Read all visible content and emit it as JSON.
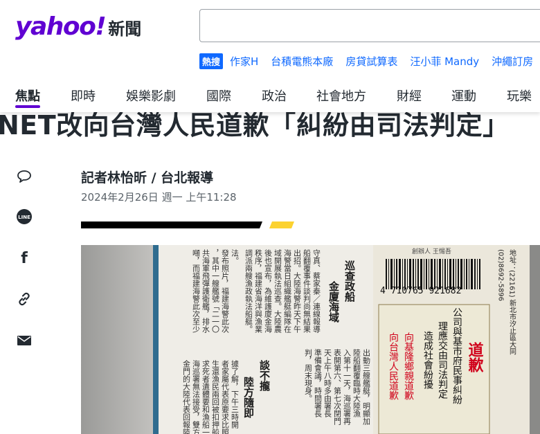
{
  "header": {
    "logo_text": "yahoo!",
    "section_label": "新聞",
    "search_placeholder": ""
  },
  "trending": {
    "badge": "熱搜",
    "items": [
      "作家H",
      "台積電熊本廠",
      "房貸試算表",
      "汪小菲 Mandy",
      "沖繩訂房"
    ]
  },
  "nav": {
    "items": [
      "焦點",
      "即時",
      "娛樂影劇",
      "國際",
      "政治",
      "社會地方",
      "財經",
      "運動",
      "玩樂"
    ],
    "active_index": 0
  },
  "article": {
    "headline": "NET改向台灣人民道歉「糾紛由司法判定」",
    "author": "記者林怡昕 / 台北報導",
    "date": "2024年2月26日 週一 上午11:28"
  },
  "share": {
    "icons": [
      "comment-icon",
      "line-icon",
      "facebook-icon",
      "link-icon",
      "mail-icon"
    ],
    "line_label": "LINE",
    "facebook_label": "f"
  },
  "photo": {
    "ad_label": "道歉",
    "ad_lines": [
      "公司與基市府民事糾紛",
      "理應交由司法判定",
      "造成社會紛擾"
    ],
    "ad_recipients": [
      "向基隆鄉親道歉",
      "向台灣人民道歉"
    ],
    "barcode_number": "4 710765 921682",
    "publisher_note": "創辦人 王惕吾",
    "address_line": "地址：(22161) 新北市汐止區大同",
    "phone_line": "(02)8692-5896",
    "news_headline_1": "金廈海域",
    "news_headline_1b": "巡查政船",
    "news_headline_2": "陸方隨即",
    "news_headline_2b": "談不攏",
    "news_col_texts": [
      "出動三艘艦艇，明顯加",
      "陸船翻覆臨時大陸漁",
      "入第十一天，海巡署再",
      "表開第六、第七次閉門",
      "天上午八時多由署長",
      "準備會議，時間署長",
      "判，周末現身。"
    ],
    "news_col_texts_2": [
      "守真、蔡家秦／連線報導",
      "船翻覆事件談判尚無結果",
      "出招。大陸海警昨天下午",
      "海警當日組織艦艇編隊在",
      "域開展執法巡查。大陸農",
      "後也宣布，為維護廈金海",
      "秩序，福建省海洋與漁業",
      "調派兩艘漁政執法船艇。"
    ],
    "news_col_texts_3": [
      "據了解，下午三時開",
      "者家屬代表原要求比照",
      "生還漁民兩回被扣押船",
      "求死者遺體要和漁船一",
      "海巡署無法接受，雙方",
      "金門的大陸代表回報陸"
    ],
    "news_col_texts_4": [
      "法。",
      "發布照片，福建海警此次",
      "，其中一艘艦號「二一〇",
      "共海軍飛彈護衛艦，排水",
      "噸，而福建海警此次至少"
    ]
  },
  "colors": {
    "brand_purple": "#6001d2",
    "link_blue": "#0f69ff",
    "ad_red": "#d0021b",
    "divider_yellow": "#fcd230"
  }
}
